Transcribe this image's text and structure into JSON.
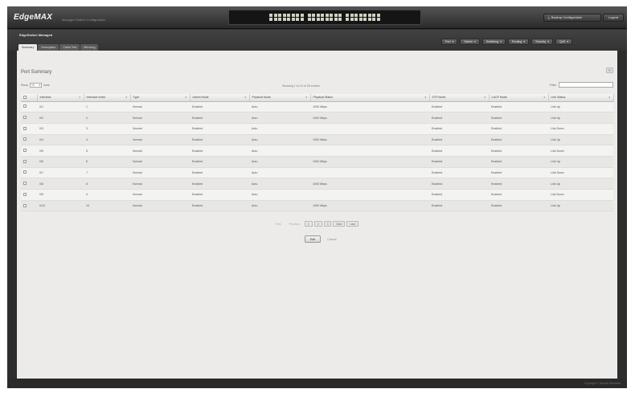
{
  "header": {
    "logo_text": "EdgeMAX",
    "logo_subtitle": "Managed Switch Configuration",
    "backup_label": "Backup Configuration",
    "logout_label": "Logout"
  },
  "subheader": {
    "device_name": "EdgeSwitch Managed",
    "menu": [
      {
        "label": "Port"
      },
      {
        "label": "Switch"
      },
      {
        "label": "Switching"
      },
      {
        "label": "Routing"
      },
      {
        "label": "Security"
      },
      {
        "label": "QoS"
      }
    ],
    "tabs": [
      {
        "label": "Summary"
      },
      {
        "label": "Description"
      },
      {
        "label": "Cable Test"
      },
      {
        "label": "Mirroring"
      }
    ]
  },
  "content": {
    "title": "Port Summary",
    "refresh_label": "↻",
    "show_label": "Show",
    "show_value": "10",
    "entries_label": "rows",
    "showing_text": "Showing 1 to 10 of 26 entries",
    "filter_label": "Filter",
    "columns": [
      {
        "label": ""
      },
      {
        "label": "Interface"
      },
      {
        "label": "Interface Index"
      },
      {
        "label": "Type"
      },
      {
        "label": "Admin Mode"
      },
      {
        "label": "Physical Mode"
      },
      {
        "label": "Physical Status"
      },
      {
        "label": "STP Mode"
      },
      {
        "label": "LACP Mode"
      },
      {
        "label": "Link Status"
      }
    ],
    "rows": [
      {
        "interface": "0/1",
        "index": "1",
        "type": "Normal",
        "admin": "Enabled",
        "phys_mode": "Auto",
        "phys_status": "1000 Mbps",
        "stp": "Enabled",
        "lacp": "Enabled",
        "link": "Link Up"
      },
      {
        "interface": "0/2",
        "index": "2",
        "type": "Normal",
        "admin": "Enabled",
        "phys_mode": "Auto",
        "phys_status": "1000 Mbps",
        "stp": "Enabled",
        "lacp": "Enabled",
        "link": "Link Up"
      },
      {
        "interface": "0/3",
        "index": "3",
        "type": "Normal",
        "admin": "Enabled",
        "phys_mode": "Auto",
        "phys_status": "",
        "stp": "Enabled",
        "lacp": "Enabled",
        "link": "Link Down"
      },
      {
        "interface": "0/4",
        "index": "4",
        "type": "Normal",
        "admin": "Enabled",
        "phys_mode": "Auto",
        "phys_status": "1000 Mbps",
        "stp": "Enabled",
        "lacp": "Enabled",
        "link": "Link Up"
      },
      {
        "interface": "0/5",
        "index": "5",
        "type": "Normal",
        "admin": "Enabled",
        "phys_mode": "Auto",
        "phys_status": "",
        "stp": "Enabled",
        "lacp": "Enabled",
        "link": "Link Down"
      },
      {
        "interface": "0/6",
        "index": "6",
        "type": "Normal",
        "admin": "Enabled",
        "phys_mode": "Auto",
        "phys_status": "1000 Mbps",
        "stp": "Enabled",
        "lacp": "Enabled",
        "link": "Link Up"
      },
      {
        "interface": "0/7",
        "index": "7",
        "type": "Normal",
        "admin": "Enabled",
        "phys_mode": "Auto",
        "phys_status": "",
        "stp": "Enabled",
        "lacp": "Enabled",
        "link": "Link Down"
      },
      {
        "interface": "0/8",
        "index": "8",
        "type": "Normal",
        "admin": "Enabled",
        "phys_mode": "Auto",
        "phys_status": "1000 Mbps",
        "stp": "Enabled",
        "lacp": "Enabled",
        "link": "Link Up"
      },
      {
        "interface": "0/9",
        "index": "9",
        "type": "Normal",
        "admin": "Enabled",
        "phys_mode": "Auto",
        "phys_status": "",
        "stp": "Enabled",
        "lacp": "Enabled",
        "link": "Link Down"
      },
      {
        "interface": "0/10",
        "index": "10",
        "type": "Normal",
        "admin": "Enabled",
        "phys_mode": "Auto",
        "phys_status": "1000 Mbps",
        "stp": "Enabled",
        "lacp": "Enabled",
        "link": "Link Up"
      }
    ],
    "pager": {
      "first": "First",
      "previous": "Previous",
      "pages": [
        "1",
        "2",
        "3"
      ],
      "next": "Next",
      "last": "Last"
    },
    "edit_label": "Edit",
    "cancel_label": "Cancel"
  },
  "footer": {
    "copyright": "Copyright © Ubiquiti Networks"
  },
  "colors": {
    "header_bg": "#2d2d2d",
    "content_bg": "#ecebe9",
    "port_led": "#cfd3c0"
  }
}
